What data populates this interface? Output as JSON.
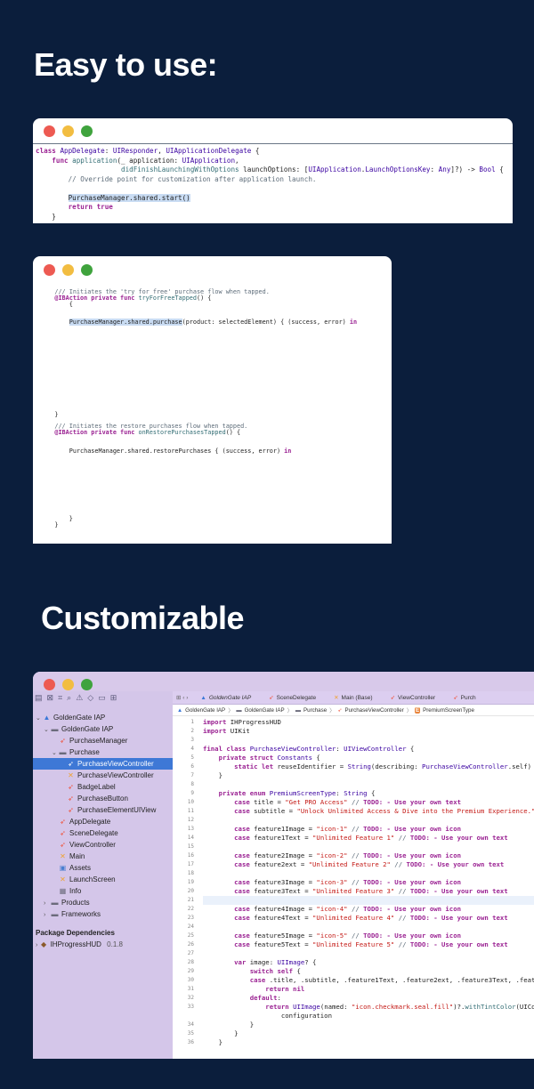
{
  "headings": {
    "easy": "Easy to use:",
    "custom": "Customizable"
  },
  "win1": {
    "lines": [
      [
        [
          "kw",
          "class "
        ],
        [
          "ty",
          "AppDelegate"
        ],
        [
          "",
          "+: "
        ],
        [
          "ty",
          "UIResponder"
        ],
        [
          "",
          ", "
        ],
        [
          "ty",
          "UIApplicationDelegate"
        ],
        [
          "",
          " {"
        ]
      ],
      [
        [
          "",
          "    "
        ],
        [
          "kw",
          "func "
        ],
        [
          "fn",
          "application"
        ],
        [
          "",
          "(_ application: "
        ],
        [
          "ty",
          "UIApplication"
        ],
        [
          "",
          ","
        ]
      ],
      [
        [
          "",
          "                     "
        ],
        [
          "fn",
          "didFinishLaunchingWithOptions"
        ],
        [
          "",
          " launchOptions: ["
        ],
        [
          "ty",
          "UIApplication"
        ],
        [
          "",
          "."
        ],
        [
          "ty",
          "LaunchOptionsKey"
        ],
        [
          "",
          ": "
        ],
        [
          "ty",
          "Any"
        ],
        [
          "",
          "]?) -> "
        ],
        [
          "ty",
          "Bool"
        ],
        [
          "",
          " {"
        ]
      ],
      [
        [
          "",
          "        "
        ],
        [
          "cm",
          "// Override point for customization after application launch."
        ]
      ],
      [
        [
          "",
          ""
        ]
      ],
      [
        [
          "",
          "        "
        ],
        [
          "hl",
          "PurchaseManager.shared.start()"
        ]
      ],
      [
        [
          "",
          "        "
        ],
        [
          "kw",
          "return "
        ],
        [
          "kw",
          "true"
        ]
      ],
      [
        [
          "",
          "    }"
        ]
      ]
    ]
  },
  "win2": {
    "lines": [
      [
        [
          "",
          ""
        ]
      ],
      [
        [
          "",
          "    "
        ],
        [
          "cm",
          "/// Initiates the 'try for free' purchase flow when tapped."
        ]
      ],
      [
        [
          "",
          "    "
        ],
        [
          "kw",
          "@IBAction private func "
        ],
        [
          "fn",
          "tryForFreeTapped"
        ],
        [
          "",
          "() {"
        ]
      ],
      [
        [
          "",
          "        {"
        ]
      ],
      [
        [
          "",
          ""
        ]
      ],
      [
        [
          "",
          ""
        ]
      ],
      [
        [
          "",
          "        "
        ],
        [
          "hl",
          "PurchaseManager.shared.purchase"
        ],
        [
          "",
          "(product: selectedElement) { (success, error) "
        ],
        [
          "kw",
          "in"
        ]
      ],
      [
        [
          "",
          ""
        ]
      ],
      [
        [
          "",
          ""
        ]
      ],
      [
        [
          "",
          ""
        ]
      ],
      [
        [
          "",
          ""
        ]
      ],
      [
        [
          "",
          ""
        ]
      ],
      [
        [
          "",
          ""
        ]
      ],
      [
        [
          "",
          ""
        ]
      ],
      [
        [
          "",
          ""
        ]
      ],
      [
        [
          "",
          ""
        ]
      ],
      [
        [
          "",
          ""
        ]
      ],
      [
        [
          "",
          ""
        ]
      ],
      [
        [
          "",
          ""
        ]
      ],
      [
        [
          "",
          ""
        ]
      ],
      [
        [
          "",
          ""
        ]
      ],
      [
        [
          "",
          "    }"
        ]
      ],
      [
        [
          "",
          ""
        ]
      ],
      [
        [
          "",
          "    "
        ],
        [
          "cm",
          "/// Initiates the restore purchases flow when tapped."
        ]
      ],
      [
        [
          "",
          "    "
        ],
        [
          "kw",
          "@IBAction private func "
        ],
        [
          "fn",
          "onRestorePurchasesTapped"
        ],
        [
          "",
          "() {"
        ]
      ],
      [
        [
          "",
          ""
        ]
      ],
      [
        [
          "",
          ""
        ]
      ],
      [
        [
          "",
          "        PurchaseManager.shared.restorePurchases { (success, error) "
        ],
        [
          "kw",
          "in"
        ]
      ],
      [
        [
          "",
          ""
        ]
      ],
      [
        [
          "",
          ""
        ]
      ],
      [
        [
          "",
          ""
        ]
      ],
      [
        [
          "",
          ""
        ]
      ],
      [
        [
          "",
          ""
        ]
      ],
      [
        [
          "",
          ""
        ]
      ],
      [
        [
          "",
          ""
        ]
      ],
      [
        [
          "",
          ""
        ]
      ],
      [
        [
          "",
          ""
        ]
      ],
      [
        [
          "",
          ""
        ]
      ],
      [
        [
          "",
          "        }"
        ]
      ],
      [
        [
          "",
          "    }"
        ]
      ]
    ]
  },
  "win3": {
    "sidebar": {
      "tools": [
        "▤",
        "⊠",
        "⌗",
        "⌕",
        "⚠",
        "◇",
        "▭",
        "⊞"
      ],
      "items": [
        {
          "label": "GoldenGate IAP",
          "indent": 0,
          "icon": "app-icon",
          "glyph": "▲",
          "arrow": "⌄"
        },
        {
          "label": "GoldenGate IAP",
          "indent": 1,
          "icon": "folder-icon",
          "glyph": "▬",
          "arrow": "⌄"
        },
        {
          "label": "PurchaseManager",
          "indent": 2,
          "icon": "swift-file-icon",
          "glyph": "➶",
          "arrow": ""
        },
        {
          "label": "Purchase",
          "indent": 2,
          "icon": "folder-icon",
          "glyph": "▬",
          "arrow": "⌄"
        },
        {
          "label": "PurchaseViewController",
          "indent": 3,
          "icon": "swift-file-icon",
          "glyph": "➶",
          "arrow": "",
          "selected": true
        },
        {
          "label": "PurchaseViewController",
          "indent": 3,
          "icon": "xib-file-icon",
          "glyph": "✕",
          "arrow": ""
        },
        {
          "label": "BadgeLabel",
          "indent": 3,
          "icon": "swift-file-icon",
          "glyph": "➶",
          "arrow": ""
        },
        {
          "label": "PurchaseButton",
          "indent": 3,
          "icon": "swift-file-icon",
          "glyph": "➶",
          "arrow": ""
        },
        {
          "label": "PurchaseElementUIView",
          "indent": 3,
          "icon": "swift-file-icon",
          "glyph": "➶",
          "arrow": ""
        },
        {
          "label": "AppDelegate",
          "indent": 2,
          "icon": "swift-file-icon",
          "glyph": "➶",
          "arrow": ""
        },
        {
          "label": "SceneDelegate",
          "indent": 2,
          "icon": "swift-file-icon",
          "glyph": "➶",
          "arrow": ""
        },
        {
          "label": "ViewController",
          "indent": 2,
          "icon": "swift-file-icon",
          "glyph": "➶",
          "arrow": ""
        },
        {
          "label": "Main",
          "indent": 2,
          "icon": "xib-file-icon",
          "glyph": "✕",
          "arrow": ""
        },
        {
          "label": "Assets",
          "indent": 2,
          "icon": "assets-icon",
          "glyph": "▣",
          "arrow": ""
        },
        {
          "label": "LaunchScreen",
          "indent": 2,
          "icon": "xib-file-icon",
          "glyph": "✕",
          "arrow": ""
        },
        {
          "label": "Info",
          "indent": 2,
          "icon": "plist-icon",
          "glyph": "▦",
          "arrow": ""
        },
        {
          "label": "Products",
          "indent": 1,
          "icon": "folder-icon",
          "glyph": "▬",
          "arrow": "›"
        },
        {
          "label": "Frameworks",
          "indent": 1,
          "icon": "folder-icon",
          "glyph": "▬",
          "arrow": "›"
        }
      ],
      "section": "Package Dependencies",
      "package": {
        "name": "IHProgressHUD",
        "version": "0.1.8"
      }
    },
    "tabs": [
      "GoldenGate IAP",
      "SceneDelegate",
      "Main (Base)",
      "ViewController",
      "Purch"
    ],
    "crumbs": [
      "GoldenGate IAP",
      "GoldenGate IAP",
      "Purchase",
      "PurchaseViewController",
      "PremiumScreenType"
    ],
    "current_line": 21,
    "lines": [
      [
        [
          "kw",
          "import "
        ],
        [
          "",
          "IHProgressHUD"
        ]
      ],
      [
        [
          "kw",
          "import "
        ],
        [
          "",
          "UIKit"
        ]
      ],
      [
        [
          "",
          ""
        ]
      ],
      [
        [
          "kw",
          "final class "
        ],
        [
          "ty",
          "PurchaseViewController"
        ],
        [
          "",
          ": "
        ],
        [
          "ty",
          "UIViewController"
        ],
        [
          "",
          " {"
        ]
      ],
      [
        [
          "",
          "    "
        ],
        [
          "kw",
          "private struct "
        ],
        [
          "ty",
          "Constants"
        ],
        [
          "",
          " {"
        ]
      ],
      [
        [
          "",
          "        "
        ],
        [
          "kw",
          "static let "
        ],
        [
          "",
          "reuseIdentifier = "
        ],
        [
          "ty",
          "String"
        ],
        [
          "",
          "(describing: "
        ],
        [
          "ty",
          "PurchaseViewController"
        ],
        [
          "",
          ".self)"
        ]
      ],
      [
        [
          "",
          "    }"
        ]
      ],
      [
        [
          "",
          ""
        ]
      ],
      [
        [
          "",
          "    "
        ],
        [
          "kw",
          "private enum "
        ],
        [
          "ty",
          "PremiumScreenType"
        ],
        [
          "",
          ": "
        ],
        [
          "ty",
          "String"
        ],
        [
          "",
          " {"
        ]
      ],
      [
        [
          "",
          "        "
        ],
        [
          "kw",
          "case "
        ],
        [
          "",
          "title = "
        ],
        [
          "str",
          "\"Get PRO Access\""
        ],
        [
          "cm",
          " // "
        ],
        [
          "kw",
          "TODO: - Use your own text"
        ]
      ],
      [
        [
          "",
          "        "
        ],
        [
          "kw",
          "case "
        ],
        [
          "",
          "subtitle = "
        ],
        [
          "str",
          "\"Unlock Unlimited Access & Dive into the Premium Experience.\""
        ]
      ],
      [
        [
          "",
          ""
        ]
      ],
      [
        [
          "",
          "        "
        ],
        [
          "kw",
          "case "
        ],
        [
          "",
          "feature1Image = "
        ],
        [
          "str",
          "\"icon-1\""
        ],
        [
          "cm",
          " // "
        ],
        [
          "kw",
          "TODO: - Use your own icon"
        ]
      ],
      [
        [
          "",
          "        "
        ],
        [
          "kw",
          "case "
        ],
        [
          "",
          "feature1Text = "
        ],
        [
          "str",
          "\"Unlimited Feature 1\""
        ],
        [
          "cm",
          " // "
        ],
        [
          "kw",
          "TODO: - Use your own text"
        ]
      ],
      [
        [
          "",
          ""
        ]
      ],
      [
        [
          "",
          "        "
        ],
        [
          "kw",
          "case "
        ],
        [
          "",
          "feature2Image = "
        ],
        [
          "str",
          "\"icon-2\""
        ],
        [
          "cm",
          " // "
        ],
        [
          "kw",
          "TODO: - Use your own icon"
        ]
      ],
      [
        [
          "",
          "        "
        ],
        [
          "kw",
          "case "
        ],
        [
          "",
          "feature2ext = "
        ],
        [
          "str",
          "\"Unlimited Feature 2\""
        ],
        [
          "cm",
          " // "
        ],
        [
          "kw",
          "TODO: - Use your own text"
        ]
      ],
      [
        [
          "",
          ""
        ]
      ],
      [
        [
          "",
          "        "
        ],
        [
          "kw",
          "case "
        ],
        [
          "",
          "feature3Image = "
        ],
        [
          "str",
          "\"icon-3\""
        ],
        [
          "cm",
          " // "
        ],
        [
          "kw",
          "TODO: - Use your own icon"
        ]
      ],
      [
        [
          "",
          "        "
        ],
        [
          "kw",
          "case "
        ],
        [
          "",
          "feature3Text = "
        ],
        [
          "str",
          "\"Unlimited Feature 3\""
        ],
        [
          "cm",
          " // "
        ],
        [
          "kw",
          "TODO: - Use your own text"
        ]
      ],
      [
        [
          "",
          ""
        ]
      ],
      [
        [
          "",
          "        "
        ],
        [
          "kw",
          "case "
        ],
        [
          "",
          "feature4Image = "
        ],
        [
          "str",
          "\"icon-4\""
        ],
        [
          "cm",
          " // "
        ],
        [
          "kw",
          "TODO: - Use your own icon"
        ]
      ],
      [
        [
          "",
          "        "
        ],
        [
          "kw",
          "case "
        ],
        [
          "",
          "feature4Text = "
        ],
        [
          "str",
          "\"Unlimited Feature 4\""
        ],
        [
          "cm",
          " // "
        ],
        [
          "kw",
          "TODO: - Use your own text"
        ]
      ],
      [
        [
          "",
          ""
        ]
      ],
      [
        [
          "",
          "        "
        ],
        [
          "kw",
          "case "
        ],
        [
          "",
          "feature5Image = "
        ],
        [
          "str",
          "\"icon-5\""
        ],
        [
          "cm",
          " // "
        ],
        [
          "kw",
          "TODO: - Use your own icon"
        ]
      ],
      [
        [
          "",
          "        "
        ],
        [
          "kw",
          "case "
        ],
        [
          "",
          "feature5Text = "
        ],
        [
          "str",
          "\"Unlimited Feature 5\""
        ],
        [
          "cm",
          " // "
        ],
        [
          "kw",
          "TODO: - Use your own text"
        ]
      ],
      [
        [
          "",
          ""
        ]
      ],
      [
        [
          "",
          "        "
        ],
        [
          "kw",
          "var "
        ],
        [
          "",
          "image: "
        ],
        [
          "ty",
          "UIImage"
        ],
        [
          "",
          "? {"
        ]
      ],
      [
        [
          "",
          "            "
        ],
        [
          "kw",
          "switch self "
        ],
        [
          "",
          "{"
        ]
      ],
      [
        [
          "",
          "            "
        ],
        [
          "kw",
          "case "
        ],
        [
          "",
          ".title, .subtitle, .feature1Text, .feature2ext, .feature3Text, .feature4Text"
        ]
      ],
      [
        [
          "",
          "                "
        ],
        [
          "kw",
          "return nil"
        ]
      ],
      [
        [
          "",
          "            "
        ],
        [
          "kw",
          "default"
        ],
        [
          "",
          ":"
        ]
      ],
      [
        [
          "",
          "                "
        ],
        [
          "kw",
          "return "
        ],
        [
          "ty",
          "UIImage"
        ],
        [
          "",
          "(named: "
        ],
        [
          "str",
          "\"icon.checkmark.seal.fill\""
        ],
        [
          "",
          ")?."
        ],
        [
          "fn",
          "withTintColor"
        ],
        [
          "",
          "(UIColor"
        ]
      ],
      [
        [
          "",
          "                    configuration"
        ]
      ],
      [
        [
          "",
          "            }"
        ]
      ],
      [
        [
          "",
          "        }"
        ]
      ],
      [
        [
          "",
          "    }"
        ]
      ]
    ],
    "line_numbers": [
      "1",
      "2",
      "3",
      "4",
      "5",
      "6",
      "7",
      "8",
      "9",
      "10",
      "11",
      "12",
      "13",
      "14",
      "15",
      "16",
      "17",
      "18",
      "19",
      "20",
      "21",
      "22",
      "23",
      "24",
      "25",
      "26",
      "27",
      "28",
      "29",
      "30",
      "31",
      "32",
      "33",
      "",
      "34",
      "35",
      "36"
    ]
  }
}
